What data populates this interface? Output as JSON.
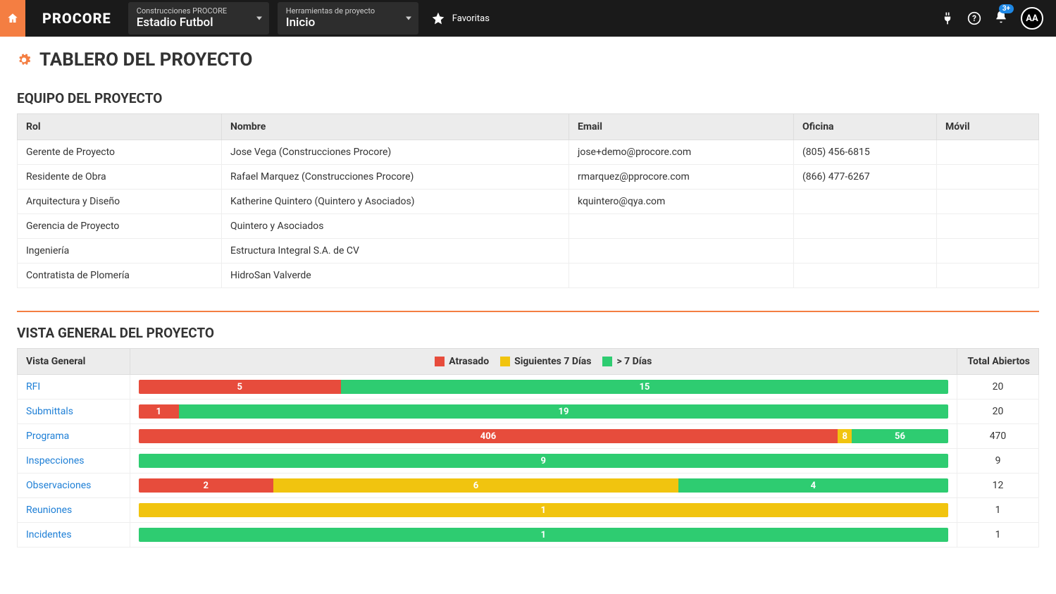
{
  "header": {
    "logo": "PROCORE",
    "selector1": {
      "label": "Construcciones PROCORE",
      "value": "Estadio Futbol"
    },
    "selector2": {
      "label": "Herramientas de proyecto",
      "value": "Inicio"
    },
    "favorites_label": "Favoritas",
    "notification_badge": "3+",
    "avatar_initials": "AA"
  },
  "page_title": "TABLERO DEL PROYECTO",
  "team": {
    "title": "EQUIPO DEL PROYECTO",
    "columns": {
      "rol": "Rol",
      "nombre": "Nombre",
      "email": "Email",
      "oficina": "Oficina",
      "movil": "Móvil"
    },
    "rows": [
      {
        "rol": "Gerente de Proyecto",
        "nombre": "Jose Vega (Construcciones Procore)",
        "email": "jose+demo@procore.com",
        "oficina": "(805) 456-6815",
        "movil": ""
      },
      {
        "rol": "Residente de Obra",
        "nombre": "Rafael Marquez (Construcciones Procore)",
        "email": "rmarquez@pprocore.com",
        "oficina": "(866) 477-6267",
        "movil": ""
      },
      {
        "rol": "Arquitectura y Diseño",
        "nombre": "Katherine Quintero (Quintero y Asociados)",
        "email": "kquintero@qya.com",
        "oficina": "",
        "movil": ""
      },
      {
        "rol": "Gerencia de Proyecto",
        "nombre": "Quintero y Asociados",
        "email": "",
        "oficina": "",
        "movil": ""
      },
      {
        "rol": "Ingeniería",
        "nombre": "Estructura Integral S.A. de CV",
        "email": "",
        "oficina": "",
        "movil": ""
      },
      {
        "rol": "Contratista de Plomería",
        "nombre": "HidroSan Valverde",
        "email": "",
        "oficina": "",
        "movil": ""
      }
    ]
  },
  "overview": {
    "title": "VISTA GENERAL DEL PROYECTO",
    "col_label": "Vista General",
    "col_total": "Total Abiertos",
    "legend": {
      "overdue": "Atrasado",
      "next7": "Siguientes 7 Días",
      "gt7": "> 7 Días"
    },
    "rows": [
      {
        "label": "RFI",
        "overdue": 5,
        "next7": 0,
        "gt7": 15,
        "total": 20
      },
      {
        "label": "Submittals",
        "overdue": 1,
        "next7": 0,
        "gt7": 19,
        "total": 20
      },
      {
        "label": "Programa",
        "overdue": 406,
        "next7": 8,
        "gt7": 56,
        "total": 470
      },
      {
        "label": "Inspecciones",
        "overdue": 0,
        "next7": 0,
        "gt7": 9,
        "total": 9
      },
      {
        "label": "Observaciones",
        "overdue": 2,
        "next7": 6,
        "gt7": 4,
        "total": 12
      },
      {
        "label": "Reuniones",
        "overdue": 0,
        "next7": 1,
        "gt7": 0,
        "total": 1
      },
      {
        "label": "Incidentes",
        "overdue": 0,
        "next7": 0,
        "gt7": 1,
        "total": 1
      }
    ]
  },
  "colors": {
    "overdue": "#e74c3c",
    "next7": "#f1c40f",
    "gt7": "#2ecc71"
  },
  "chart_data": {
    "type": "bar",
    "title": "Vista General del Proyecto",
    "orientation": "horizontal-stacked",
    "categories": [
      "RFI",
      "Submittals",
      "Programa",
      "Inspecciones",
      "Observaciones",
      "Reuniones",
      "Incidentes"
    ],
    "series": [
      {
        "name": "Atrasado",
        "color": "#e74c3c",
        "values": [
          5,
          1,
          406,
          0,
          2,
          0,
          0
        ]
      },
      {
        "name": "Siguientes 7 Días",
        "color": "#f1c40f",
        "values": [
          0,
          0,
          8,
          0,
          6,
          1,
          0
        ]
      },
      {
        "name": "> 7 Días",
        "color": "#2ecc71",
        "values": [
          15,
          19,
          56,
          9,
          4,
          0,
          1
        ]
      }
    ],
    "totals": [
      20,
      20,
      470,
      9,
      12,
      1,
      1
    ]
  }
}
